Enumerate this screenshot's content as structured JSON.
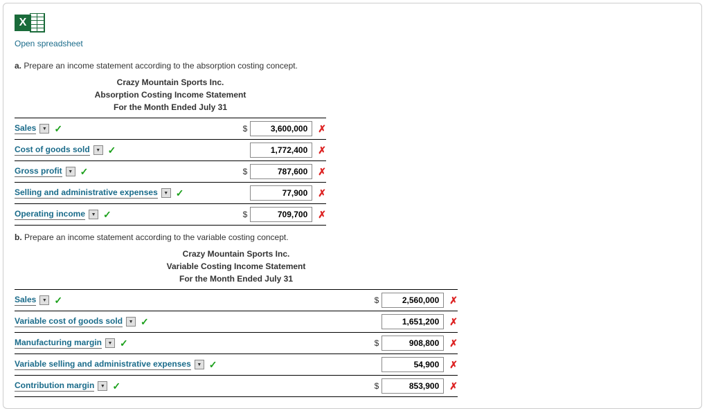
{
  "open_link": "Open spreadsheet",
  "part_a": {
    "letter": "a.",
    "prompt": "Prepare an income statement according to the absorption costing concept.",
    "header1": "Crazy Mountain Sports Inc.",
    "header2": "Absorption Costing Income Statement",
    "header3": "For the Month Ended July 31",
    "rows": [
      {
        "label": "Sales",
        "dollar": "$",
        "value": "3,600,000"
      },
      {
        "label": "Cost of goods sold",
        "dollar": "",
        "value": "1,772,400"
      },
      {
        "label": "Gross profit",
        "dollar": "$",
        "value": "787,600"
      },
      {
        "label": "Selling and administrative expenses",
        "dollar": "",
        "value": "77,900"
      },
      {
        "label": "Operating income",
        "dollar": "$",
        "value": "709,700"
      }
    ]
  },
  "part_b": {
    "letter": "b.",
    "prompt": "Prepare an income statement according to the variable costing concept.",
    "header1": "Crazy Mountain Sports Inc.",
    "header2": "Variable Costing Income Statement",
    "header3": "For the Month Ended July 31",
    "rows": [
      {
        "label": "Sales",
        "dollar": "$",
        "value": "2,560,000"
      },
      {
        "label": "Variable cost of goods sold",
        "dollar": "",
        "value": "1,651,200"
      },
      {
        "label": "Manufacturing margin",
        "dollar": "$",
        "value": "908,800"
      },
      {
        "label": "Variable selling and administrative expenses",
        "dollar": "",
        "value": "54,900"
      },
      {
        "label": "Contribution margin",
        "dollar": "$",
        "value": "853,900"
      }
    ]
  }
}
